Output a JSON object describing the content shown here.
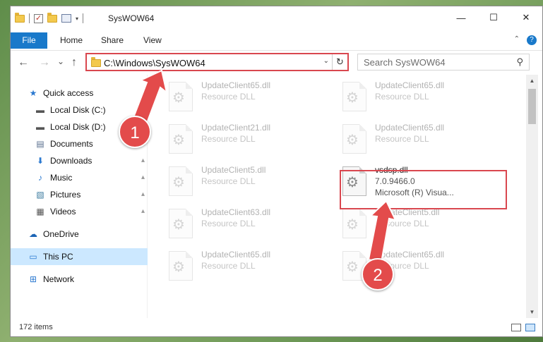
{
  "window": {
    "title": "SysWOW64"
  },
  "titlebar": {
    "minimize": "—",
    "maximize": "☐",
    "close": "✕",
    "qat_check": "✓",
    "qat_dropdown": "▾"
  },
  "ribbon": {
    "tabs": [
      "File",
      "Home",
      "Share",
      "View"
    ],
    "collapse_label": "⌃",
    "help_label": "?"
  },
  "nav": {
    "back": "←",
    "forward": "→",
    "recent": "⌄",
    "up": "↑",
    "address": "C:\\Windows\\SysWOW64",
    "address_dropdown": "⌄",
    "refresh": "↻",
    "search_placeholder": "Search SysWOW64",
    "search_icon": "⚲"
  },
  "sidebar": {
    "items": [
      {
        "label": "Quick access",
        "icon": "star-icon",
        "glyph": "★",
        "pinned": false
      },
      {
        "label": "Local Disk (C:)",
        "icon": "drive-icon",
        "glyph": "▬",
        "pinned": true
      },
      {
        "label": "Local Disk (D:)",
        "icon": "drive-icon",
        "glyph": "▬",
        "pinned": false
      },
      {
        "label": "Documents",
        "icon": "documents-icon",
        "glyph": "▤",
        "pinned": true
      },
      {
        "label": "Downloads",
        "icon": "downloads-icon",
        "glyph": "⬇",
        "pinned": true
      },
      {
        "label": "Music",
        "icon": "music-icon",
        "glyph": "♪",
        "pinned": true
      },
      {
        "label": "Pictures",
        "icon": "pictures-icon",
        "glyph": "▧",
        "pinned": true
      },
      {
        "label": "Videos",
        "icon": "videos-icon",
        "glyph": "▦",
        "pinned": true
      },
      {
        "label": "OneDrive",
        "icon": "onedrive-icon",
        "glyph": "☁",
        "pinned": false
      },
      {
        "label": "This PC",
        "icon": "this-pc-icon",
        "glyph": "▭",
        "pinned": false,
        "selected": true
      },
      {
        "label": "Network",
        "icon": "network-icon",
        "glyph": "⊞",
        "pinned": false
      }
    ],
    "pin_glyph": "📌"
  },
  "files": [
    {
      "name": "UpdateClient65.dll",
      "type": "Resource DLL",
      "faded": true
    },
    {
      "name": "UpdateClient65.dll",
      "type": "Resource DLL",
      "faded": true
    },
    {
      "name": "UpdateClient21.dll",
      "type": "Resource DLL",
      "faded": true
    },
    {
      "name": "UpdateClient65.dll",
      "type": "Resource DLL",
      "faded": true
    },
    {
      "name": "UpdateClient5.dll",
      "type": "Resource DLL",
      "faded": true
    },
    {
      "name": "vsdsp.dll",
      "version": "7.0.9466.0",
      "type": "Microsoft (R) Visua...",
      "faded": false
    },
    {
      "name": "UpdateClient63.dll",
      "type": "Resource DLL",
      "faded": true
    },
    {
      "name": "UpdateClient5.dll",
      "type": "Resource DLL",
      "faded": true
    },
    {
      "name": "UpdateClient65.dll",
      "type": "Resource DLL",
      "faded": true
    },
    {
      "name": "UpdateClient65.dll",
      "type": "Resource DLL",
      "faded": true
    }
  ],
  "gear_glyph": "⚙",
  "status": {
    "item_count": "172 items"
  },
  "scrollbar": {
    "up": "▲",
    "down": "▼"
  },
  "annotations": {
    "badge_1": "1",
    "badge_2": "2",
    "accent": "#e34b4b"
  }
}
